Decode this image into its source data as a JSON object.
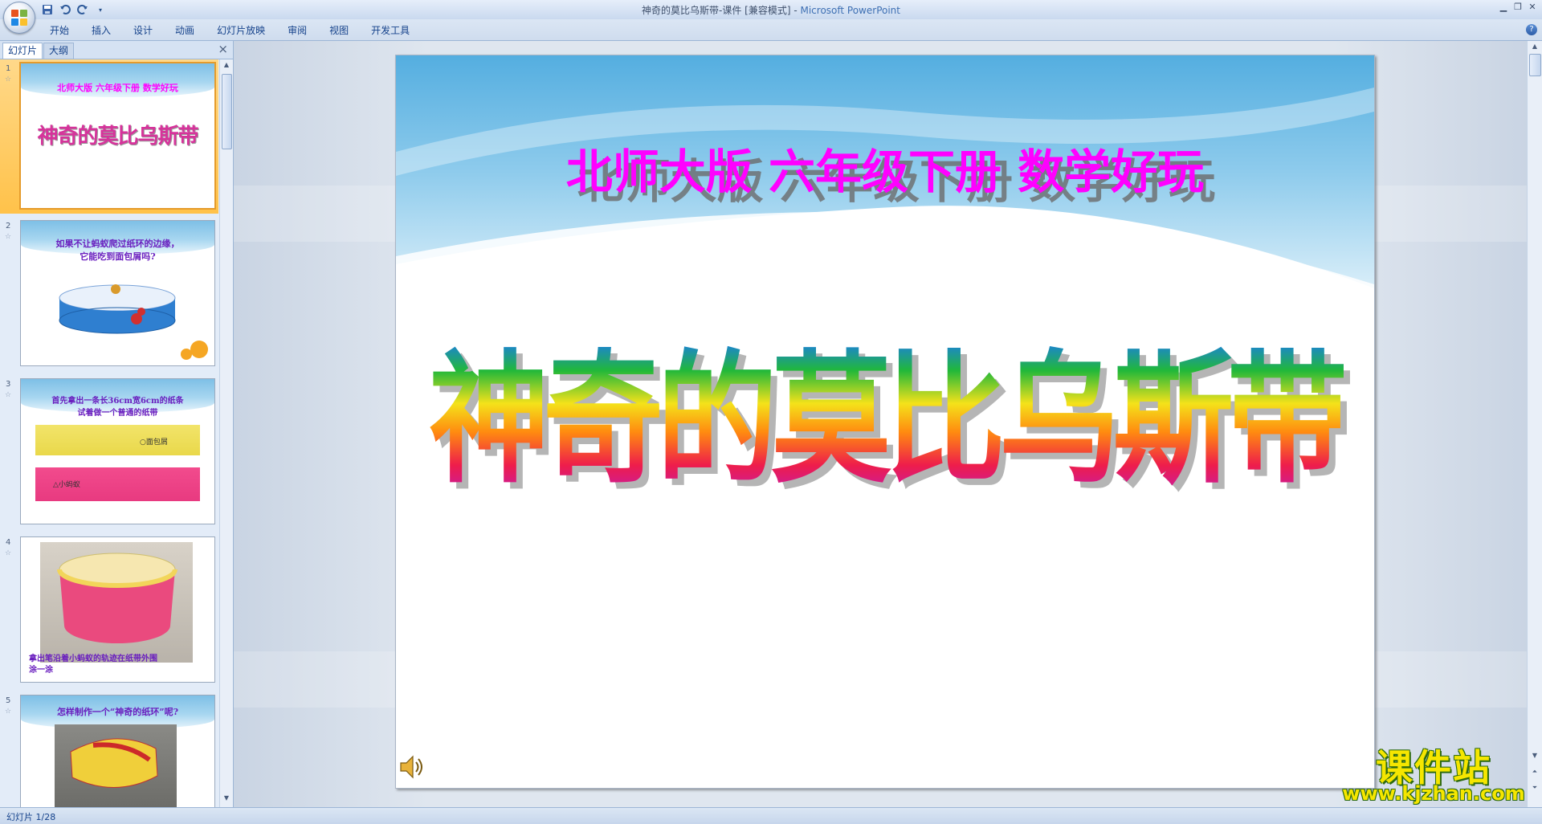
{
  "window": {
    "title": "神奇的莫比乌斯带-课件 [兼容模式] - ",
    "app_name": "Microsoft PowerPoint"
  },
  "quick_access": {
    "save_icon": "save-icon",
    "undo_icon": "undo-icon",
    "redo_icon": "redo-icon",
    "customize_icon": "dropdown-icon"
  },
  "ribbon": {
    "tabs": [
      "开始",
      "插入",
      "设计",
      "动画",
      "幻灯片放映",
      "审阅",
      "视图",
      "开发工具"
    ]
  },
  "left_panel": {
    "tab_slides": "幻灯片",
    "tab_outline": "大纲",
    "close_label": "×",
    "thumbnails": [
      {
        "num": "1",
        "line1": "北师大版 六年级下册  数学好玩",
        "line2": "神奇的莫比乌斯带"
      },
      {
        "num": "2",
        "line1": "如果不让蚂蚁爬过纸环的边缘，",
        "line2": "它能吃到面包屑吗?"
      },
      {
        "num": "3",
        "line1": "首先拿出一条长36cm宽6cm的纸条",
        "line2": "试着做一个普通的纸带",
        "label_a": "面包屑",
        "label_b": "小蚂蚁"
      },
      {
        "num": "4",
        "line1": "拿出笔沿着小蚂蚁的轨迹在纸带外围",
        "line2": "涂一涂"
      },
      {
        "num": "5",
        "line1": "怎样制作一个“神奇的纸环”呢?"
      }
    ]
  },
  "slide": {
    "subtitle": "北师大版  六年级下册    数学好玩",
    "title": "神奇的莫比乌斯带"
  },
  "status": {
    "slide_counter": "幻灯片 1/28"
  },
  "watermark": {
    "title": "课件站",
    "url": "www.kjzhan.com"
  },
  "colors": {
    "subtitle": "#ff00ff",
    "ribbon_text": "#15428b",
    "selection": "#ffc24a"
  }
}
